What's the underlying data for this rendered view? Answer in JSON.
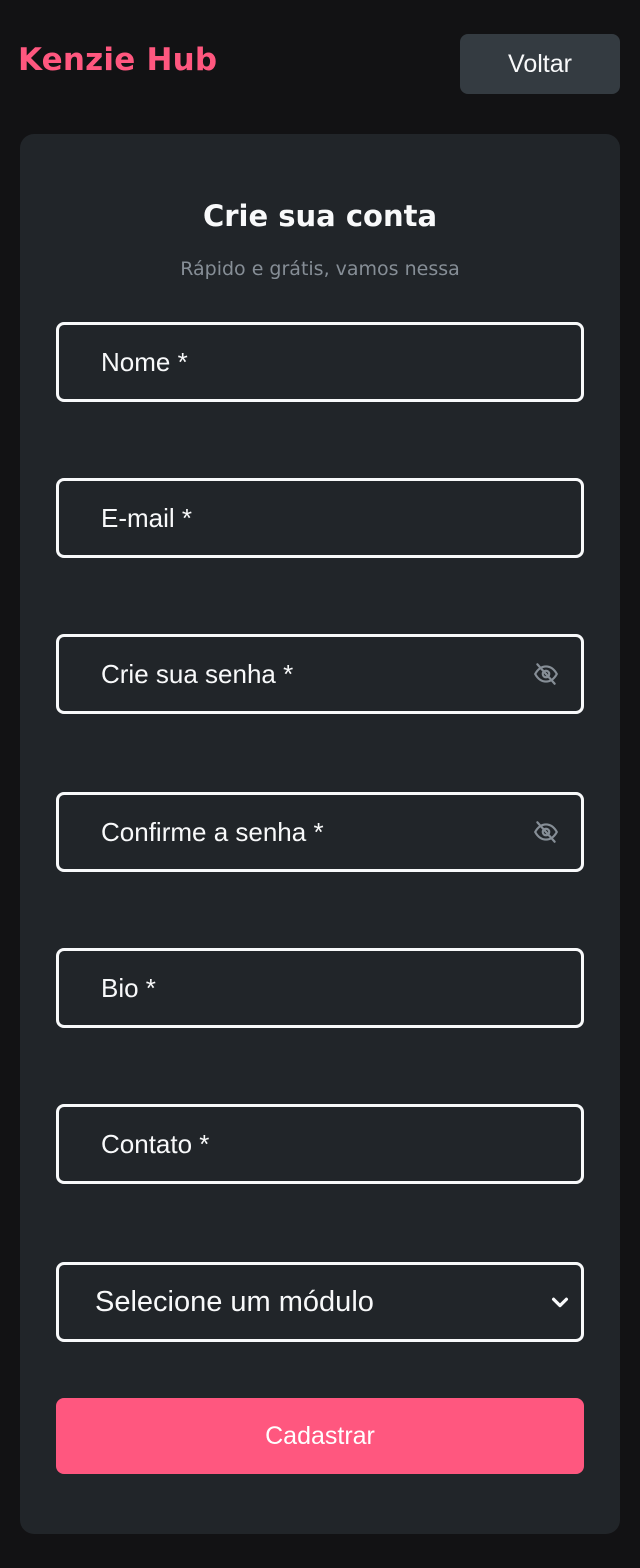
{
  "header": {
    "logo": "Kenzie Hub",
    "back_label": "Voltar"
  },
  "form": {
    "title": "Crie sua conta",
    "subtitle": "Rápido e grátis, vamos nessa",
    "fields": {
      "name": {
        "placeholder": "Nome *",
        "value": ""
      },
      "email": {
        "placeholder": "E-mail *",
        "value": ""
      },
      "password": {
        "placeholder": "Crie sua senha *",
        "value": "",
        "icon": "eye-off-icon"
      },
      "confirm_password": {
        "placeholder": "Confirme a senha *",
        "value": "",
        "icon": "eye-off-icon"
      },
      "bio": {
        "placeholder": "Bio *",
        "value": ""
      },
      "contact": {
        "placeholder": "Contato *",
        "value": ""
      }
    },
    "module_select": {
      "selected": "Selecione um módulo",
      "icon": "chevron-down-icon"
    },
    "submit_label": "Cadastrar"
  },
  "colors": {
    "background": "#121214",
    "card": "#212529",
    "accent": "#ff577f",
    "secondary_button": "#343b41",
    "text": "#f8f9fa",
    "muted_text": "#868e96"
  }
}
